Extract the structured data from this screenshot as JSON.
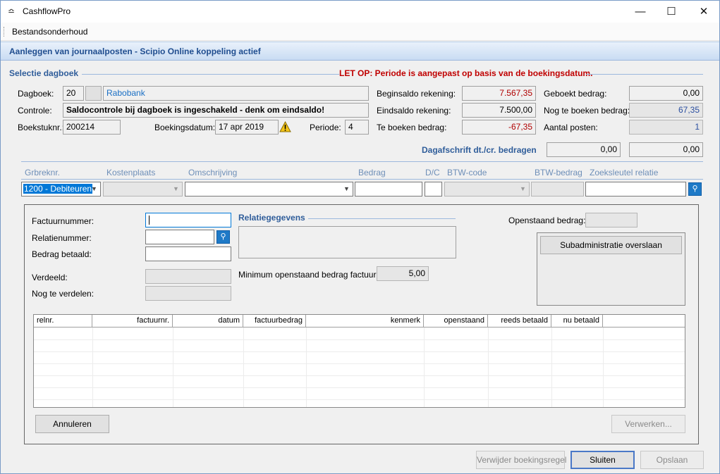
{
  "window": {
    "title": "CashflowPro",
    "minimize": "—",
    "maximize": "☐",
    "close": "✕",
    "icon": "≏"
  },
  "menu": {
    "items": [
      "Bestandsonderhoud"
    ]
  },
  "banner": {
    "text": "Aanleggen van journaalposten - Scipio Online koppeling actief"
  },
  "header": {
    "section_title": "Selectie dagboek",
    "warning": "LET OP: Periode is aangepast op basis van de boekingsdatum.",
    "dagboek_label": "Dagboek:",
    "dagboek_code": "20",
    "dagboek_name": "Rabobank",
    "controle_label": "Controle:",
    "controle_text": "Saldocontrole bij dagboek is ingeschakeld - denk om eindsaldo!",
    "boekstuk_label": "Boekstuknr.:",
    "boekstuk_value": "200214",
    "boekingsdatum_label": "Boekingsdatum:",
    "boekingsdatum_value": "17 apr 2019",
    "periode_label": "Periode:",
    "periode_value": "4",
    "beginsaldo_label": "Beginsaldo rekening:",
    "beginsaldo_value": "7.567,35",
    "eindsaldo_label": "Eindsaldo rekening:",
    "eindsaldo_value": "7.500,00",
    "te_boeken_label": "Te boeken bedrag:",
    "te_boeken_value": "-67,35",
    "geboekt_label": "Geboekt bedrag:",
    "geboekt_value": "0,00",
    "nog_te_boeken_label": "Nog te boeken bedrag:",
    "nog_te_boeken_value": "67,35",
    "aantal_posten_label": "Aantal posten:",
    "aantal_posten_value": "1",
    "dagafschrift_label": "Dagafschrift dt./cr. bedragen",
    "dagafschrift_dt": "0,00",
    "dagafschrift_cr": "0,00"
  },
  "entry": {
    "columns": [
      "Grbreknr.",
      "Kostenplaats",
      "Omschrijving",
      "Bedrag",
      "D/C",
      "BTW-code",
      "BTW-bedrag",
      "Zoeksleutel relatie"
    ],
    "grbreknr_value": "1200 - Debiteuren"
  },
  "sub": {
    "factuurnummer_label": "Factuurnummer:",
    "relatienummer_label": "Relatienummer:",
    "bedrag_betaald_label": "Bedrag betaald:",
    "verdeeld_label": "Verdeeld:",
    "nog_te_verdelen_label": "Nog te verdelen:",
    "relatiegegevens_title": "Relatiegegevens",
    "min_openstaand_label": "Minimum openstaand bedrag factuur:",
    "min_openstaand_value": "5,00",
    "openstaand_label": "Openstaand bedrag:",
    "subadmin_button": "Subadministratie overslaan",
    "table_columns": [
      "relnr.",
      "factuurnr.",
      "datum",
      "factuurbedrag",
      "kenmerk",
      "openstaand",
      "reeds betaald",
      "nu betaald"
    ],
    "annuleren_button": "Annuleren",
    "verwerken_button": "Verwerken..."
  },
  "footer": {
    "verwijder_button": "Verwijder boekingsregel",
    "sluiten_button": "Sluiten",
    "opslaan_button": "Opslaan"
  },
  "colors": {
    "accent": "#2f5d9a",
    "warning": "#c00000",
    "negative": "#b00000",
    "search": "#1f7ac7"
  }
}
